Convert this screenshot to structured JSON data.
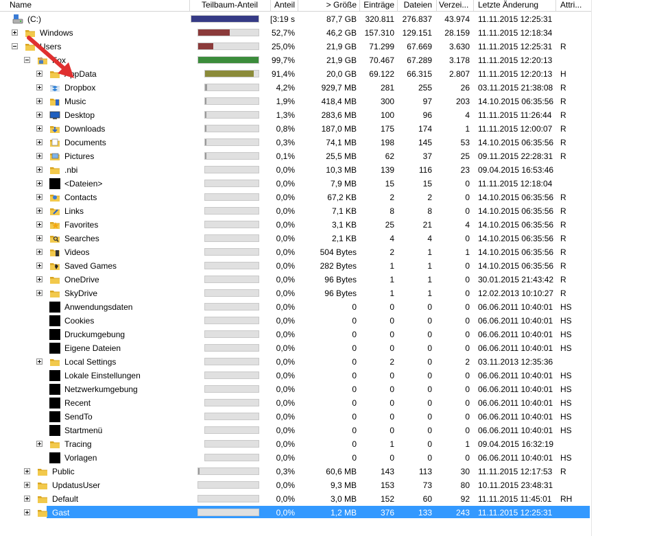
{
  "columns": {
    "name": "Name",
    "share_bar": "Teilbaum-Anteil",
    "share": "Anteil",
    "size": "> Größe",
    "entries": "Einträge",
    "files": "Dateien",
    "dirs": "Verzei...",
    "modified": "Letzte Änderung",
    "attr": "Attri..."
  },
  "colors": {
    "bar_blue": "#363b86",
    "bar_red": "#8b3a3a",
    "bar_green": "#3b8c3b",
    "bar_olive": "#8b8b3a",
    "bar_gray": "#9a9a9a",
    "selection": "#3399ff",
    "arrow": "#e03030"
  },
  "rows": [
    {
      "name": "(C:)",
      "level": 0,
      "expander": "none",
      "icon": "drive-icon",
      "share_bar": 1.0,
      "bar_color": "bar_blue",
      "share": "[3:19 s]",
      "size": "87,7 GB",
      "entries": "320.811",
      "files": "276.837",
      "dirs": "43.974",
      "modified": "11.11.2015  12:25:31",
      "attr": ""
    },
    {
      "name": "Windows",
      "level": 1,
      "expander": "plus",
      "icon": "folder-icon",
      "share_bar": 0.527,
      "bar_color": "bar_red",
      "share": "52,7%",
      "size": "46,2 GB",
      "entries": "157.310",
      "files": "129.151",
      "dirs": "28.159",
      "modified": "11.11.2015  12:18:34",
      "attr": ""
    },
    {
      "name": "Users",
      "level": 1,
      "expander": "minus",
      "icon": "folder-icon",
      "share_bar": 0.25,
      "bar_color": "bar_red",
      "share": "25,0%",
      "size": "21,9 GB",
      "entries": "71.299",
      "files": "67.669",
      "dirs": "3.630",
      "modified": "11.11.2015  12:25:31",
      "attr": "R"
    },
    {
      "name": "Fox",
      "level": 2,
      "expander": "minus",
      "icon": "user-folder-icon",
      "share_bar": 0.997,
      "bar_color": "bar_green",
      "share": "99,7%",
      "size": "21,9 GB",
      "entries": "70.467",
      "files": "67.289",
      "dirs": "3.178",
      "modified": "11.11.2015  12:20:13",
      "attr": ""
    },
    {
      "name": "AppData",
      "level": 3,
      "expander": "plus",
      "icon": "folder-icon",
      "share_bar": 0.914,
      "bar_color": "bar_olive",
      "share": "91,4%",
      "size": "20,0 GB",
      "entries": "69.122",
      "files": "66.315",
      "dirs": "2.807",
      "modified": "11.11.2015  12:20:13",
      "attr": "H"
    },
    {
      "name": "Dropbox",
      "level": 3,
      "expander": "plus",
      "icon": "dropbox-icon",
      "share_bar": 0.042,
      "bar_color": "bar_gray",
      "share": "4,2%",
      "size": "929,7 MB",
      "entries": "281",
      "files": "255",
      "dirs": "26",
      "modified": "03.11.2015  21:38:08",
      "attr": "R"
    },
    {
      "name": "Music",
      "level": 3,
      "expander": "plus",
      "icon": "music-folder-icon",
      "share_bar": 0.019,
      "bar_color": "bar_gray",
      "share": "1,9%",
      "size": "418,4 MB",
      "entries": "300",
      "files": "97",
      "dirs": "203",
      "modified": "14.10.2015  06:35:56",
      "attr": "R"
    },
    {
      "name": "Desktop",
      "level": 3,
      "expander": "plus",
      "icon": "desktop-icon",
      "share_bar": 0.013,
      "bar_color": "bar_gray",
      "share": "1,3%",
      "size": "283,6 MB",
      "entries": "100",
      "files": "96",
      "dirs": "4",
      "modified": "11.11.2015  11:26:44",
      "attr": "R"
    },
    {
      "name": "Downloads",
      "level": 3,
      "expander": "plus",
      "icon": "downloads-icon",
      "share_bar": 0.008,
      "bar_color": "bar_gray",
      "share": "0,8%",
      "size": "187,0 MB",
      "entries": "175",
      "files": "174",
      "dirs": "1",
      "modified": "11.11.2015  12:00:07",
      "attr": "R"
    },
    {
      "name": "Documents",
      "level": 3,
      "expander": "plus",
      "icon": "documents-icon",
      "share_bar": 0.003,
      "bar_color": "bar_gray",
      "share": "0,3%",
      "size": "74,1 MB",
      "entries": "198",
      "files": "145",
      "dirs": "53",
      "modified": "14.10.2015  06:35:56",
      "attr": "R"
    },
    {
      "name": "Pictures",
      "level": 3,
      "expander": "plus",
      "icon": "pictures-icon",
      "share_bar": 0.001,
      "bar_color": "bar_gray",
      "share": "0,1%",
      "size": "25,5 MB",
      "entries": "62",
      "files": "37",
      "dirs": "25",
      "modified": "09.11.2015  22:28:31",
      "attr": "R"
    },
    {
      "name": ".nbi",
      "level": 3,
      "expander": "plus",
      "icon": "folder-icon",
      "share_bar": 0,
      "bar_color": "bar_gray",
      "share": "0,0%",
      "size": "10,3 MB",
      "entries": "139",
      "files": "116",
      "dirs": "23",
      "modified": "09.04.2015  16:53:46",
      "attr": ""
    },
    {
      "name": "<Dateien>",
      "level": 3,
      "expander": "plus",
      "icon": "files-block-icon",
      "share_bar": 0,
      "bar_color": "bar_gray",
      "share": "0,0%",
      "size": "7,9 MB",
      "entries": "15",
      "files": "15",
      "dirs": "0",
      "modified": "11.11.2015  12:18:04",
      "attr": ""
    },
    {
      "name": "Contacts",
      "level": 3,
      "expander": "plus",
      "icon": "contacts-icon",
      "share_bar": 0,
      "bar_color": "bar_gray",
      "share": "0,0%",
      "size": "67,2 KB",
      "entries": "2",
      "files": "2",
      "dirs": "0",
      "modified": "14.10.2015  06:35:56",
      "attr": "R"
    },
    {
      "name": "Links",
      "level": 3,
      "expander": "plus",
      "icon": "links-icon",
      "share_bar": 0,
      "bar_color": "bar_gray",
      "share": "0,0%",
      "size": "7,1 KB",
      "entries": "8",
      "files": "8",
      "dirs": "0",
      "modified": "14.10.2015  06:35:56",
      "attr": "R"
    },
    {
      "name": "Favorites",
      "level": 3,
      "expander": "plus",
      "icon": "favorites-icon",
      "share_bar": 0,
      "bar_color": "bar_gray",
      "share": "0,0%",
      "size": "3,1 KB",
      "entries": "25",
      "files": "21",
      "dirs": "4",
      "modified": "14.10.2015  06:35:56",
      "attr": "R"
    },
    {
      "name": "Searches",
      "level": 3,
      "expander": "plus",
      "icon": "searches-icon",
      "share_bar": 0,
      "bar_color": "bar_gray",
      "share": "0,0%",
      "size": "2,1 KB",
      "entries": "4",
      "files": "4",
      "dirs": "0",
      "modified": "14.10.2015  06:35:56",
      "attr": "R"
    },
    {
      "name": "Videos",
      "level": 3,
      "expander": "plus",
      "icon": "videos-icon",
      "share_bar": 0,
      "bar_color": "bar_gray",
      "share": "0,0%",
      "size": "504 Bytes",
      "entries": "2",
      "files": "1",
      "dirs": "1",
      "modified": "14.10.2015  06:35:56",
      "attr": "R"
    },
    {
      "name": "Saved Games",
      "level": 3,
      "expander": "plus",
      "icon": "saved-games-icon",
      "share_bar": 0,
      "bar_color": "bar_gray",
      "share": "0,0%",
      "size": "282 Bytes",
      "entries": "1",
      "files": "1",
      "dirs": "0",
      "modified": "14.10.2015  06:35:56",
      "attr": "R"
    },
    {
      "name": "OneDrive",
      "level": 3,
      "expander": "plus",
      "icon": "folder-icon",
      "share_bar": 0,
      "bar_color": "bar_gray",
      "share": "0,0%",
      "size": "96 Bytes",
      "entries": "1",
      "files": "1",
      "dirs": "0",
      "modified": "30.01.2015  21:43:42",
      "attr": "R"
    },
    {
      "name": "SkyDrive",
      "level": 3,
      "expander": "plus",
      "icon": "folder-icon",
      "share_bar": 0,
      "bar_color": "bar_gray",
      "share": "0,0%",
      "size": "96 Bytes",
      "entries": "1",
      "files": "1",
      "dirs": "0",
      "modified": "12.02.2013  10:10:27",
      "attr": "R"
    },
    {
      "name": "Anwendungsdaten",
      "level": 3,
      "expander": "none",
      "icon": "junction-icon",
      "share_bar": 0,
      "bar_color": "bar_gray",
      "share": "0,0%",
      "size": "0",
      "entries": "0",
      "files": "0",
      "dirs": "0",
      "modified": "06.06.2011  10:40:01",
      "attr": "HS"
    },
    {
      "name": "Cookies",
      "level": 3,
      "expander": "none",
      "icon": "junction-icon",
      "share_bar": 0,
      "bar_color": "bar_gray",
      "share": "0,0%",
      "size": "0",
      "entries": "0",
      "files": "0",
      "dirs": "0",
      "modified": "06.06.2011  10:40:01",
      "attr": "HS"
    },
    {
      "name": "Druckumgebung",
      "level": 3,
      "expander": "none",
      "icon": "junction-icon",
      "share_bar": 0,
      "bar_color": "bar_gray",
      "share": "0,0%",
      "size": "0",
      "entries": "0",
      "files": "0",
      "dirs": "0",
      "modified": "06.06.2011  10:40:01",
      "attr": "HS"
    },
    {
      "name": "Eigene Dateien",
      "level": 3,
      "expander": "none",
      "icon": "junction-icon",
      "share_bar": 0,
      "bar_color": "bar_gray",
      "share": "0,0%",
      "size": "0",
      "entries": "0",
      "files": "0",
      "dirs": "0",
      "modified": "06.06.2011  10:40:01",
      "attr": "HS"
    },
    {
      "name": "Local Settings",
      "level": 3,
      "expander": "plus",
      "icon": "folder-icon",
      "share_bar": 0,
      "bar_color": "bar_gray",
      "share": "0,0%",
      "size": "0",
      "entries": "2",
      "files": "0",
      "dirs": "2",
      "modified": "03.11.2013  12:35:36",
      "attr": ""
    },
    {
      "name": "Lokale Einstellungen",
      "level": 3,
      "expander": "none",
      "icon": "junction-icon",
      "share_bar": 0,
      "bar_color": "bar_gray",
      "share": "0,0%",
      "size": "0",
      "entries": "0",
      "files": "0",
      "dirs": "0",
      "modified": "06.06.2011  10:40:01",
      "attr": "HS"
    },
    {
      "name": "Netzwerkumgebung",
      "level": 3,
      "expander": "none",
      "icon": "junction-icon",
      "share_bar": 0,
      "bar_color": "bar_gray",
      "share": "0,0%",
      "size": "0",
      "entries": "0",
      "files": "0",
      "dirs": "0",
      "modified": "06.06.2011  10:40:01",
      "attr": "HS"
    },
    {
      "name": "Recent",
      "level": 3,
      "expander": "none",
      "icon": "junction-icon",
      "share_bar": 0,
      "bar_color": "bar_gray",
      "share": "0,0%",
      "size": "0",
      "entries": "0",
      "files": "0",
      "dirs": "0",
      "modified": "06.06.2011  10:40:01",
      "attr": "HS"
    },
    {
      "name": "SendTo",
      "level": 3,
      "expander": "none",
      "icon": "junction-icon",
      "share_bar": 0,
      "bar_color": "bar_gray",
      "share": "0,0%",
      "size": "0",
      "entries": "0",
      "files": "0",
      "dirs": "0",
      "modified": "06.06.2011  10:40:01",
      "attr": "HS"
    },
    {
      "name": "Startmenü",
      "level": 3,
      "expander": "none",
      "icon": "junction-icon",
      "share_bar": 0,
      "bar_color": "bar_gray",
      "share": "0,0%",
      "size": "0",
      "entries": "0",
      "files": "0",
      "dirs": "0",
      "modified": "06.06.2011  10:40:01",
      "attr": "HS"
    },
    {
      "name": "Tracing",
      "level": 3,
      "expander": "plus",
      "icon": "folder-icon",
      "share_bar": 0,
      "bar_color": "bar_gray",
      "share": "0,0%",
      "size": "0",
      "entries": "1",
      "files": "0",
      "dirs": "1",
      "modified": "09.04.2015  16:32:19",
      "attr": ""
    },
    {
      "name": "Vorlagen",
      "level": 3,
      "expander": "none",
      "icon": "junction-icon",
      "share_bar": 0,
      "bar_color": "bar_gray",
      "share": "0,0%",
      "size": "0",
      "entries": "0",
      "files": "0",
      "dirs": "0",
      "modified": "06.06.2011  10:40:01",
      "attr": "HS"
    },
    {
      "name": "Public",
      "level": 2,
      "expander": "plus",
      "icon": "folder-icon",
      "share_bar": 0.003,
      "bar_color": "bar_gray",
      "share": "0,3%",
      "size": "60,6 MB",
      "entries": "143",
      "files": "113",
      "dirs": "30",
      "modified": "11.11.2015  12:17:53",
      "attr": "R"
    },
    {
      "name": "UpdatusUser",
      "level": 2,
      "expander": "plus",
      "icon": "folder-icon",
      "share_bar": 0,
      "bar_color": "bar_gray",
      "share": "0,0%",
      "size": "9,3 MB",
      "entries": "153",
      "files": "73",
      "dirs": "80",
      "modified": "10.11.2015  23:48:31",
      "attr": ""
    },
    {
      "name": "Default",
      "level": 2,
      "expander": "plus",
      "icon": "folder-icon",
      "share_bar": 0,
      "bar_color": "bar_gray",
      "share": "0,0%",
      "size": "3,0 MB",
      "entries": "152",
      "files": "60",
      "dirs": "92",
      "modified": "11.11.2015  11:45:01",
      "attr": "RH"
    },
    {
      "name": "Gast",
      "level": 2,
      "expander": "plus",
      "icon": "folder-icon",
      "share_bar": 0,
      "bar_color": "bar_gray",
      "share": "0,0%",
      "size": "1,2 MB",
      "entries": "376",
      "files": "133",
      "dirs": "243",
      "modified": "11.11.2015  12:25:31",
      "attr": "",
      "selected": true
    }
  ]
}
